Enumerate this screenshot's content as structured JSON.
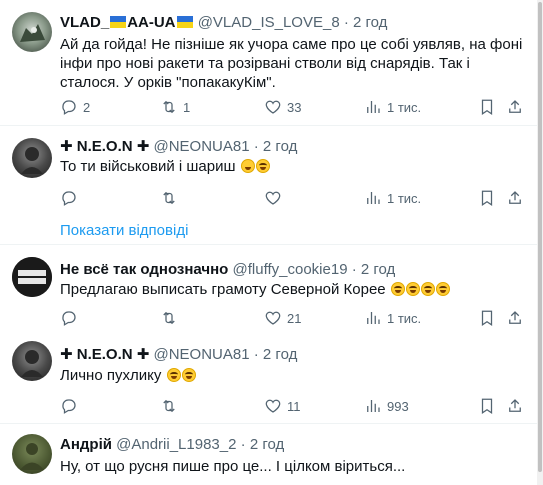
{
  "posts": [
    {
      "name_before": "VLAD_",
      "name_middle": "AA-UA",
      "handle_before": "@VLAD_IS_LOVE_8",
      "time": "2 год",
      "text": "Ай да гойда! Не пізніше як учора саме про це собі уявляв, на фоні інфи про нові ракети  та розірвані стволи від снарядів. Так і сталося. У орків \"попакакуКім\".",
      "replies": "2",
      "reposts": "1",
      "likes": "33",
      "views": "1 тис."
    },
    {
      "name": "✚ N.E.O.N ✚",
      "handle": "@NEONUA81",
      "time": "2 год",
      "text": "То ти військовий і шариш",
      "replies": "",
      "reposts": "",
      "likes": "",
      "views": "1 тис.",
      "show_replies": "Показати відповіді"
    },
    {
      "name": "Не всё так однозначно",
      "handle": "@fluffy_cookie19",
      "time": "2 год",
      "text": "Предлагаю выписать грамоту Северной Корее",
      "replies": "",
      "reposts": "",
      "likes": "21",
      "views": "1 тис."
    },
    {
      "name": "✚ N.E.O.N ✚",
      "handle": "@NEONUA81",
      "time": "2 год",
      "text": "Лично пухлику",
      "replies": "",
      "reposts": "",
      "likes": "11",
      "views": "993"
    },
    {
      "name": "Андрій",
      "handle": "@Andrii_L1983_2",
      "time": "2 год",
      "text": "Ну, от що русня пише про це... І цілком віриться..."
    }
  ],
  "separator_dot": "·",
  "colors": {
    "link": "#1d9bf0",
    "muted": "#536471",
    "text": "#0f1419"
  }
}
